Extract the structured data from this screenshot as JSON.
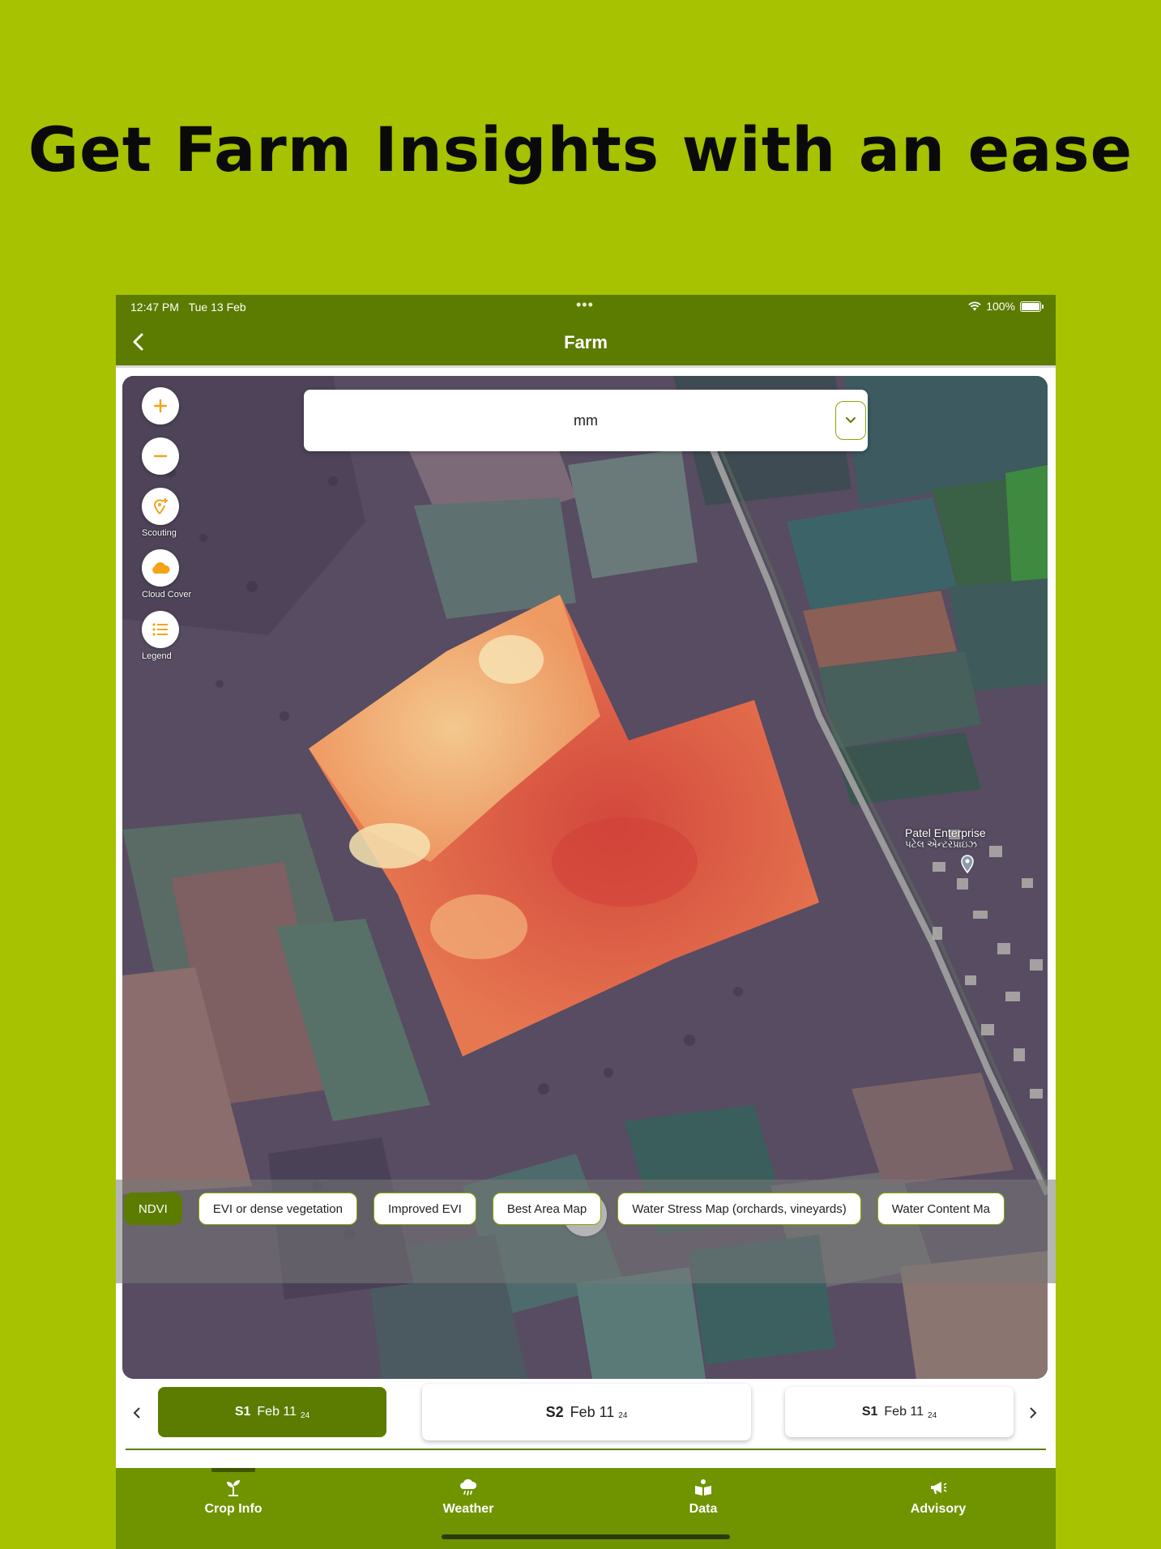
{
  "headline": "Get Farm Insights with an ease",
  "status": {
    "time": "12:47 PM",
    "date": "Tue 13 Feb",
    "battery": "100%"
  },
  "appbar": {
    "title": "Farm"
  },
  "map": {
    "dropdown_value": "mm",
    "controls": {
      "scouting": "Scouting",
      "cloud_cover": "Cloud Cover",
      "legend": "Legend"
    },
    "poi": {
      "name": "Patel Enterprise",
      "name_local": "પટેલ એન્ટરપ્રાઇઝ"
    }
  },
  "layers": [
    {
      "label": "NDVI",
      "active": true
    },
    {
      "label": "EVI or dense vegetation"
    },
    {
      "label": "Improved EVI"
    },
    {
      "label": "Best Area Map"
    },
    {
      "label": "Water Stress Map (orchards, vineyards)"
    },
    {
      "label": "Water Content Ma"
    }
  ],
  "dates": [
    {
      "sat": "S1",
      "date": "Feb 11",
      "year": "24",
      "active": true
    },
    {
      "sat": "S2",
      "date": "Feb 11",
      "year": "24"
    },
    {
      "sat": "S1",
      "date": "Feb 11",
      "year": "24"
    }
  ],
  "tabs": [
    {
      "label": "Crop Info",
      "icon": "sprout-icon",
      "active": true
    },
    {
      "label": "Weather",
      "icon": "rain-cloud-icon"
    },
    {
      "label": "Data",
      "icon": "book-reader-icon"
    },
    {
      "label": "Advisory",
      "icon": "megaphone-icon"
    }
  ],
  "colors": {
    "background": "#a6c200",
    "primary": "#5b7c00",
    "tabbar": "#6f9400",
    "accent": "#f5a21b"
  }
}
